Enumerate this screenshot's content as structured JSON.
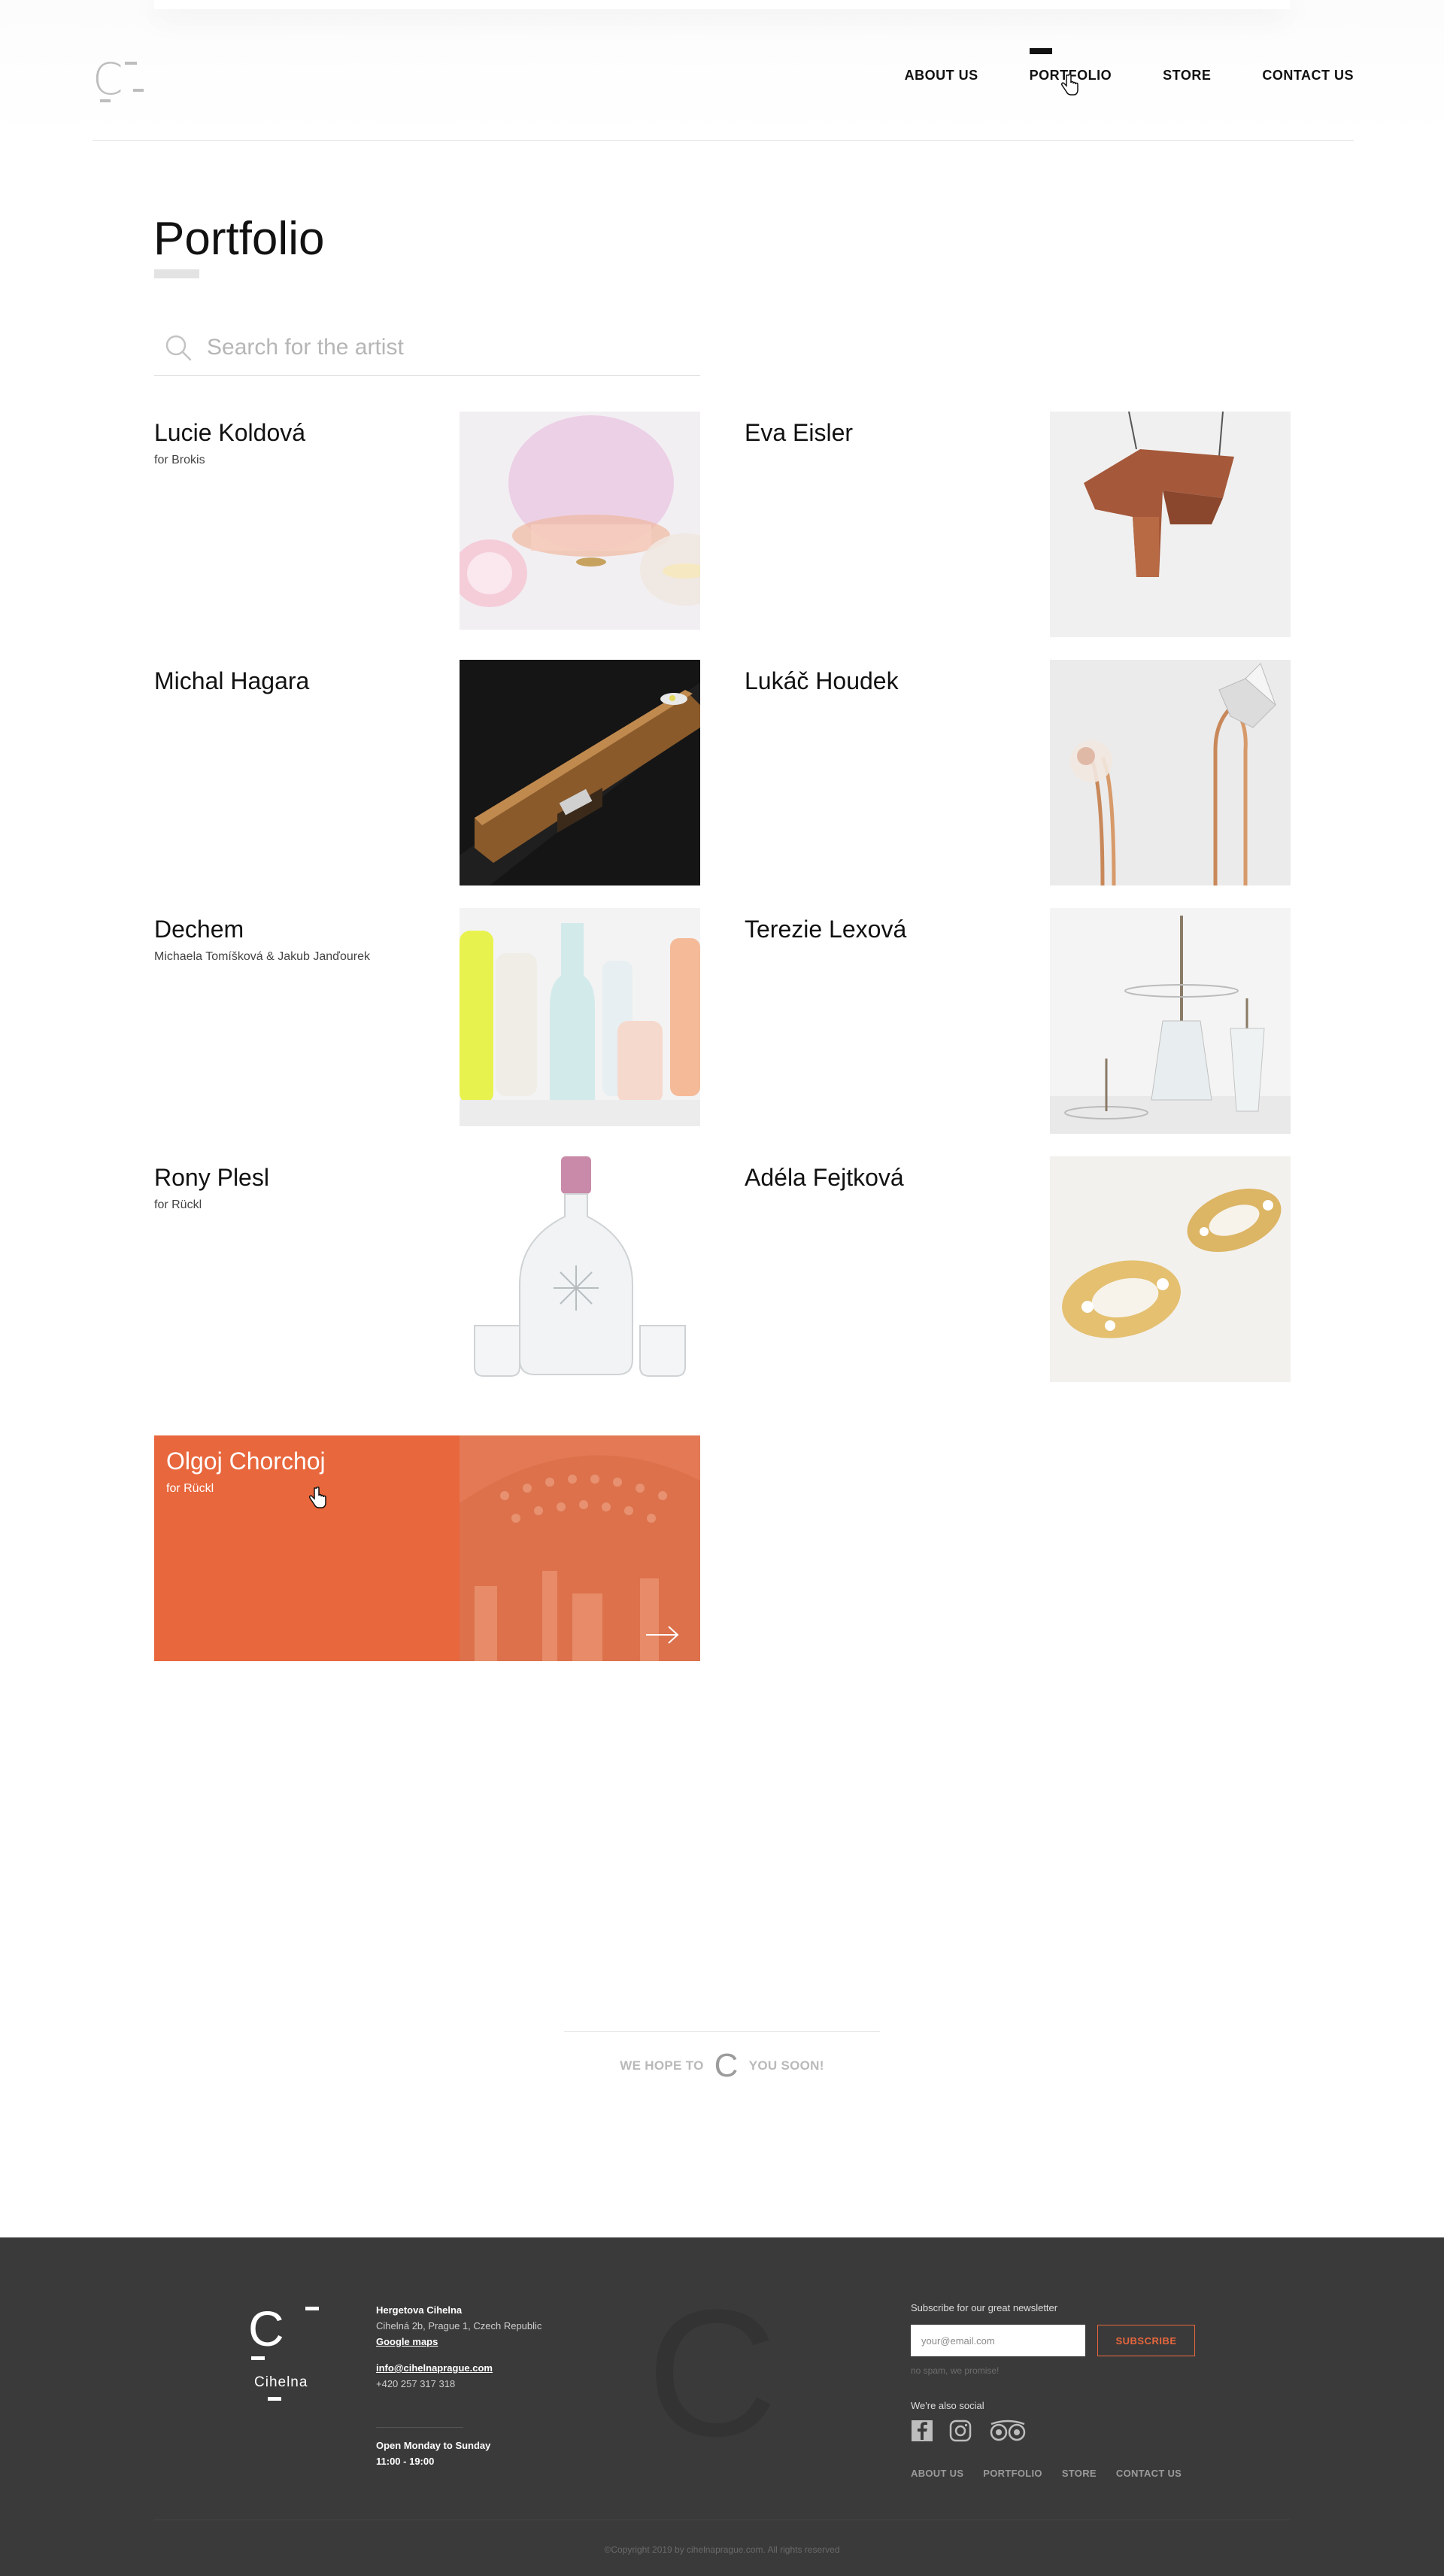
{
  "nav": {
    "items": [
      {
        "label": "ABOUT US",
        "active": false
      },
      {
        "label": "PORTFOLIO",
        "active": true
      },
      {
        "label": "STORE",
        "active": false
      },
      {
        "label": "CONTACT US",
        "active": false
      }
    ]
  },
  "page": {
    "title": "Portfolio",
    "search_placeholder": "Search for the artist"
  },
  "artists": [
    {
      "name": "Lucie Koldová",
      "subtitle": "for Brokis"
    },
    {
      "name": "Eva Eisler",
      "subtitle": ""
    },
    {
      "name": "Michal Hagara",
      "subtitle": ""
    },
    {
      "name": "Lukáč Houdek",
      "subtitle": ""
    },
    {
      "name": "Dechem",
      "subtitle": "Michaela Tomíšková & Jakub Janďourek"
    },
    {
      "name": "Terezie Lexová",
      "subtitle": ""
    },
    {
      "name": "Rony Plesl",
      "subtitle": "for Rückl"
    },
    {
      "name": "Adéla Fejtková",
      "subtitle": ""
    },
    {
      "name": "Olgoj Chorchoj",
      "subtitle": "for Rückl",
      "hovered": true
    }
  ],
  "banner": {
    "left": "WE HOPE TO",
    "right": "YOU SOON!"
  },
  "footer": {
    "logo_label": "Cihelna",
    "address": {
      "name": "Hergetova Cihelna",
      "street": "Cihelná 2b, Prague 1, Czech Republic",
      "maps_link": "Google maps",
      "email": "info@cihelnaprague.com",
      "phone": "+420 257 317 318"
    },
    "hours": {
      "days": "Open Monday to Sunday",
      "time": "11:00 - 19:00"
    },
    "newsletter": {
      "label": "Subscribe for our great newsletter",
      "placeholder": "your@email.com",
      "button": "SUBSCRIBE",
      "note": "no spam, we promise!"
    },
    "social_label": "We're also social",
    "nav": [
      "ABOUT US",
      "PORTFOLIO",
      "STORE",
      "CONTACT US"
    ],
    "copyright": "©Copyright 2019 by cihelnaprague.com. All rights reserved"
  },
  "colors": {
    "accent": "#e8673d",
    "footer_bg": "#3a3a3a",
    "text": "#111111"
  }
}
